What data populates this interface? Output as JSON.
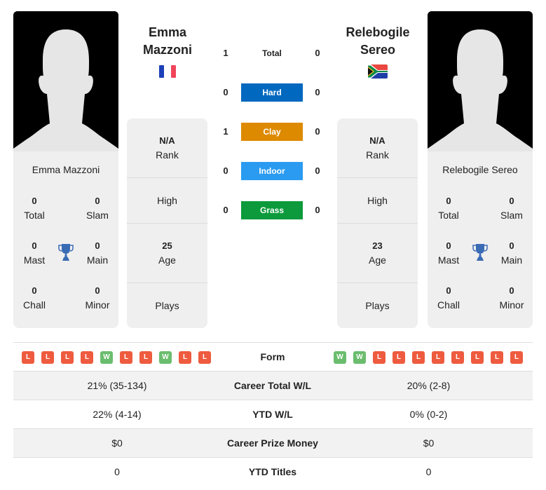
{
  "colors": {
    "hard": "#0068bf",
    "clay": "#dd8a00",
    "indoor": "#2a9bf0",
    "grass": "#0c9a3c",
    "win": "#6bbd6e",
    "loss": "#ee5b3f",
    "trophy": "#3a6bb5"
  },
  "players": [
    {
      "side": "left",
      "title_line1": "Emma",
      "title_line2": "Mazzoni",
      "full_name": "Emma Mazzoni",
      "flag": "france-flag",
      "titles": {
        "total": {
          "value": "0",
          "label": "Total"
        },
        "slam": {
          "value": "0",
          "label": "Slam"
        },
        "mast": {
          "value": "0",
          "label": "Mast"
        },
        "main": {
          "value": "0",
          "label": "Main"
        },
        "chall": {
          "value": "0",
          "label": "Chall"
        },
        "minor": {
          "value": "0",
          "label": "Minor"
        }
      },
      "info": {
        "rank": {
          "value": "N/A",
          "label": "Rank"
        },
        "high": {
          "value": "",
          "label": "High"
        },
        "age": {
          "value": "25",
          "label": "Age"
        },
        "plays": {
          "value": "",
          "label": "Plays"
        }
      },
      "form": [
        "L",
        "L",
        "L",
        "L",
        "W",
        "L",
        "L",
        "W",
        "L",
        "L"
      ]
    },
    {
      "side": "right",
      "title_line1": "Relebogile",
      "title_line2": "Sereo",
      "full_name": "Relebogile Sereo",
      "flag": "south-africa-flag",
      "titles": {
        "total": {
          "value": "0",
          "label": "Total"
        },
        "slam": {
          "value": "0",
          "label": "Slam"
        },
        "mast": {
          "value": "0",
          "label": "Mast"
        },
        "main": {
          "value": "0",
          "label": "Main"
        },
        "chall": {
          "value": "0",
          "label": "Chall"
        },
        "minor": {
          "value": "0",
          "label": "Minor"
        }
      },
      "info": {
        "rank": {
          "value": "N/A",
          "label": "Rank"
        },
        "high": {
          "value": "",
          "label": "High"
        },
        "age": {
          "value": "23",
          "label": "Age"
        },
        "plays": {
          "value": "",
          "label": "Plays"
        }
      },
      "form": [
        "W",
        "W",
        "L",
        "L",
        "L",
        "L",
        "L",
        "L",
        "L",
        "L"
      ]
    }
  ],
  "h2h_surfaces": [
    {
      "key": "total",
      "label": "Total",
      "left": "1",
      "right": "0"
    },
    {
      "key": "hard",
      "label": "Hard",
      "left": "0",
      "right": "0"
    },
    {
      "key": "clay",
      "label": "Clay",
      "left": "1",
      "right": "0"
    },
    {
      "key": "indoor",
      "label": "Indoor",
      "left": "0",
      "right": "0"
    },
    {
      "key": "grass",
      "label": "Grass",
      "left": "0",
      "right": "0"
    }
  ],
  "comparison": {
    "form_label": "Form",
    "rows": [
      {
        "label": "Career Total W/L",
        "left": "21% (35-134)",
        "right": "20% (2-8)"
      },
      {
        "label": "YTD W/L",
        "left": "22% (4-14)",
        "right": "0% (0-2)"
      },
      {
        "label": "Career Prize Money",
        "left": "$0",
        "right": "$0"
      },
      {
        "label": "YTD Titles",
        "left": "0",
        "right": "0"
      }
    ]
  }
}
